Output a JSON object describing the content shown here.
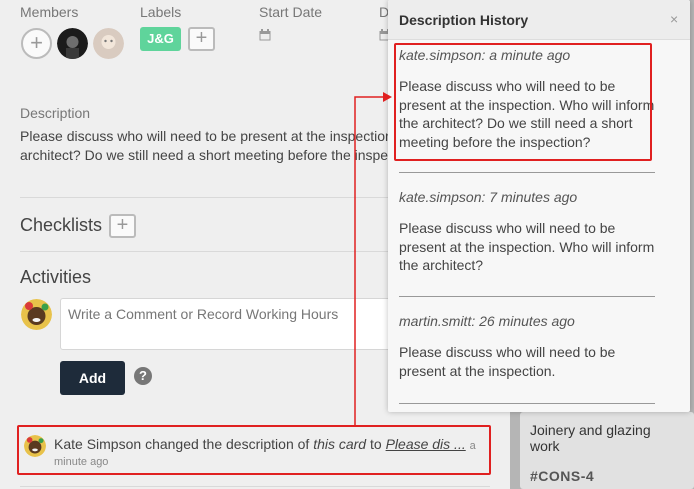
{
  "header": {
    "members_label": "Members",
    "labels_label": "Labels",
    "start_date_label": "Start Date",
    "due_date_label_partial": "D"
  },
  "labels": {
    "chip": "J&G",
    "chip_color": "#5fd49b"
  },
  "description": {
    "label": "Description",
    "text": "Please discuss who will need to be present at the inspection. Who will inform the architect? Do we still need a short meeting before the inspection?"
  },
  "checklists": {
    "title": "Checklists"
  },
  "activities": {
    "title": "Activities",
    "comment_placeholder": "Write a Comment or Record Working Hours",
    "add_label": "Add",
    "help_glyph": "?",
    "entry": {
      "actor": "Kate Simpson",
      "action": "changed the description of",
      "object": "this card",
      "to": "to",
      "link": "Please dis ...",
      "time_a": "a",
      "time_rest": "minute ago"
    }
  },
  "history": {
    "title": "Description History",
    "close_glyph": "×",
    "items": [
      {
        "meta": "kate.simpson: a minute ago",
        "text": "Please discuss who will need to be present at the inspection. Who will inform the architect? Do we still need a short meeting before the inspection?"
      },
      {
        "meta": "kate.simpson: 7 minutes ago",
        "text": "Please discuss who will need to be present at the inspection. Who will inform the architect?"
      },
      {
        "meta": "martin.smitt: 26 minutes ago",
        "text": "Please discuss who will need to be present at the inspection."
      }
    ]
  },
  "board_card": {
    "title": "Joinery and glazing work",
    "code": "#CONS-4"
  },
  "colors": {
    "highlight": "#e02020",
    "add_button": "#1e2b3a"
  },
  "icons": [
    "plus-icon",
    "calendar-icon",
    "help-icon",
    "close-icon"
  ]
}
